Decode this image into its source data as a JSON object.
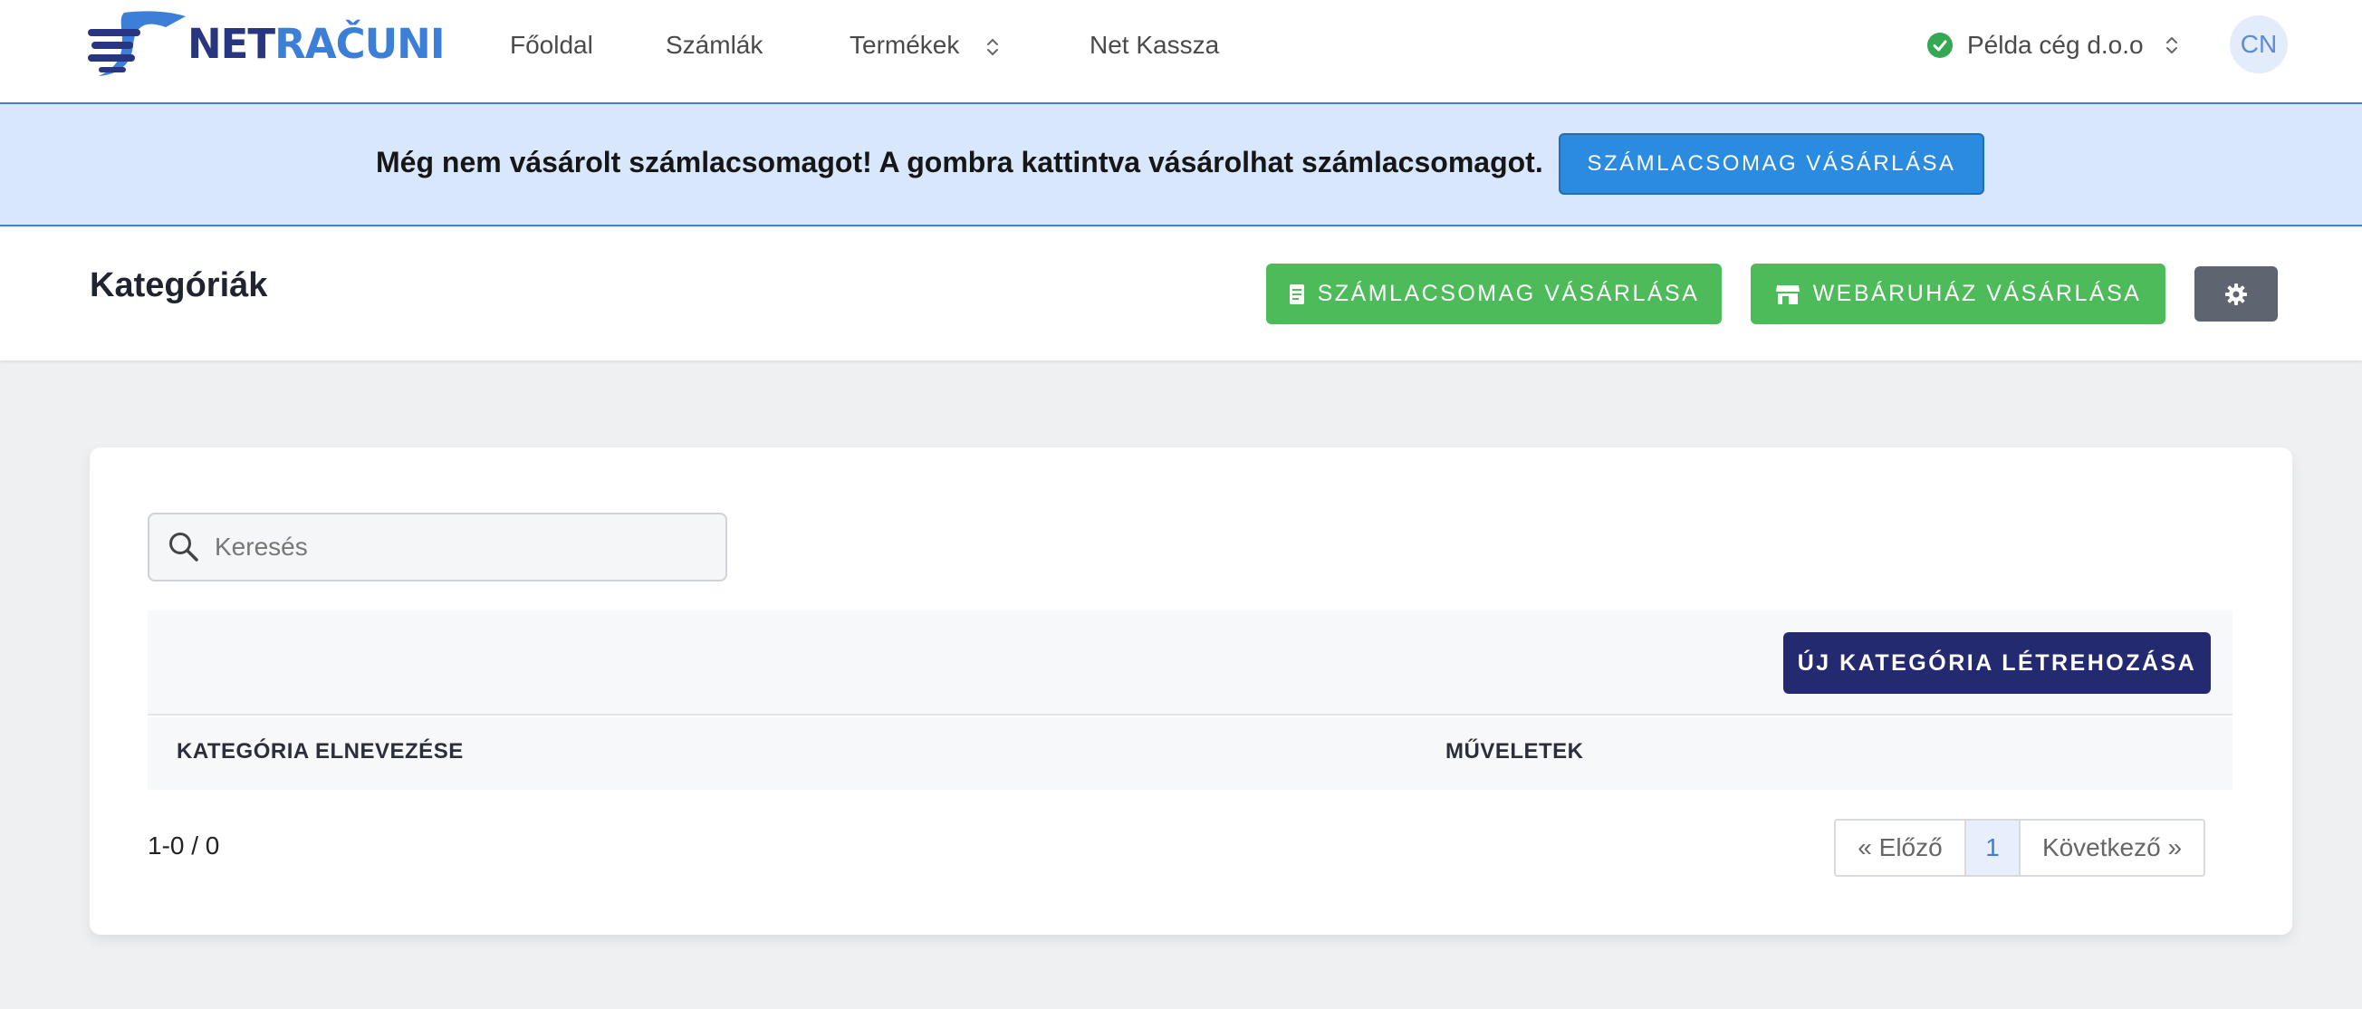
{
  "brand": {
    "net": "NET",
    "racuni": "RAČUNI"
  },
  "nav": {
    "items": [
      {
        "label": "Főoldal"
      },
      {
        "label": "Számlák"
      },
      {
        "label": "Termékek"
      },
      {
        "label": "Net Kassza"
      }
    ],
    "company": "Példa cég d.o.o",
    "avatar_initials": "CN"
  },
  "banner": {
    "text": "Még nem vásárolt számlacsomagot! A gombra kattintva vásárolhat számlacsomagot.",
    "button": "SZÁMLACSOMAG VÁSÁRLÁSA"
  },
  "header": {
    "title": "Kategóriák",
    "buy_package": "SZÁMLACSOMAG VÁSÁRLÁSA",
    "buy_webshop": "WEBÁRUHÁZ VÁSÁRLÁSA"
  },
  "search": {
    "placeholder": "Keresés"
  },
  "table": {
    "new_button": "ÚJ KATEGÓRIA LÉTREHOZÁSA",
    "columns": [
      "KATEGÓRIA ELNEVEZÉSE",
      "MŰVELETEK"
    ],
    "count": "1-0 / 0"
  },
  "pagination": {
    "prev": "« Előző",
    "current": "1",
    "next": "Következő »"
  },
  "colors": {
    "accent_blue": "#2b8be1",
    "success_green": "#4dbb5a",
    "navy": "#242a6f",
    "banner_bg": "#d8e7fb"
  }
}
